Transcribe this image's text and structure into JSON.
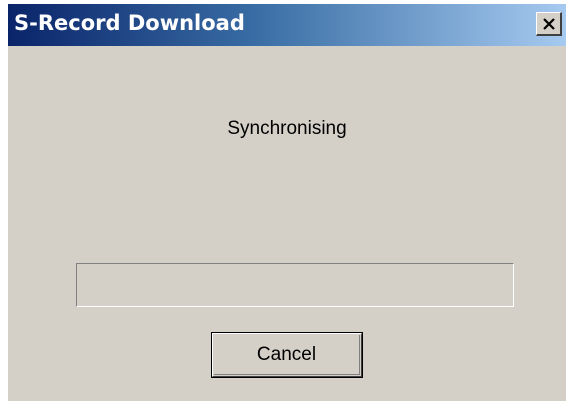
{
  "window": {
    "title": "S-Record Download",
    "close_icon": "close-icon"
  },
  "status": {
    "text": "Synchronising"
  },
  "progress": {
    "fraction": 0
  },
  "buttons": {
    "cancel_label": "Cancel"
  },
  "colors": {
    "face": "#d4d0c8",
    "title_start": "#0a246a",
    "title_end": "#a6caf0",
    "title_text": "#ffffff"
  }
}
